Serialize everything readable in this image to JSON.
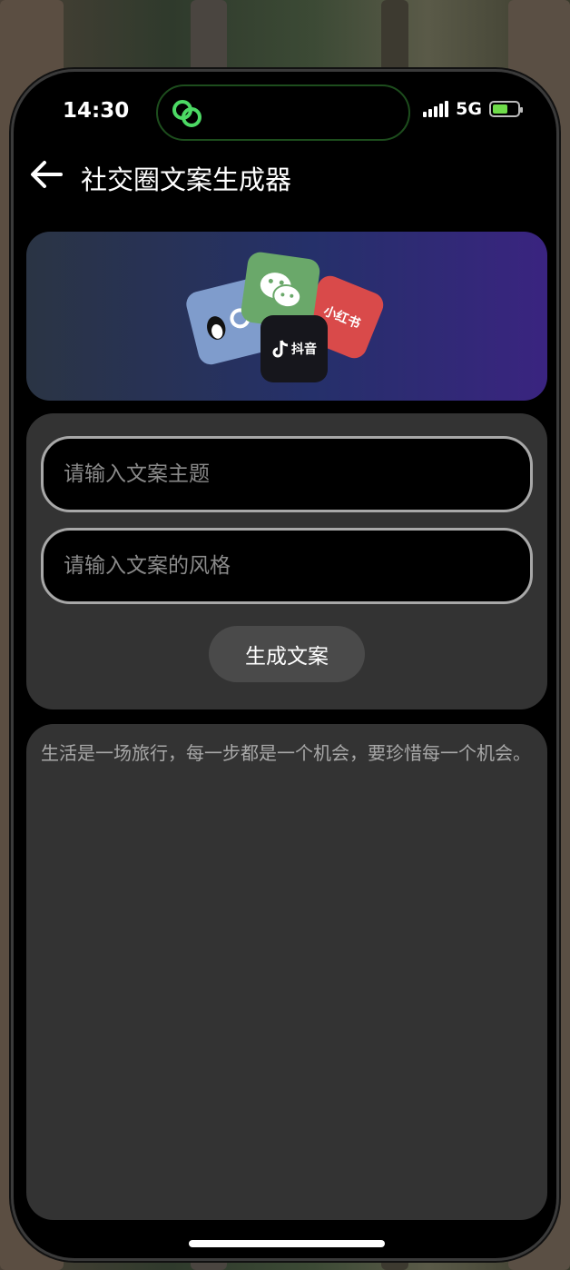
{
  "status_bar": {
    "time": "14:30",
    "network": "5G",
    "island_icon": "link-icon",
    "battery_color": "#6fdc4a"
  },
  "nav": {
    "back_icon": "arrow-left-icon",
    "title": "社交圈文案生成器"
  },
  "banner": {
    "cards": [
      {
        "name": "qq",
        "label": "Q"
      },
      {
        "name": "wechat",
        "label": ""
      },
      {
        "name": "xiaohongshu",
        "label": "小红书"
      },
      {
        "name": "douyin",
        "label": "抖音"
      }
    ]
  },
  "form": {
    "topic_placeholder": "请输入文案主题",
    "style_placeholder": "请输入文案的风格",
    "generate_label": "生成文案"
  },
  "result": {
    "text": "生活是一场旅行，每一步都是一个机会，要珍惜每一个机会。"
  }
}
